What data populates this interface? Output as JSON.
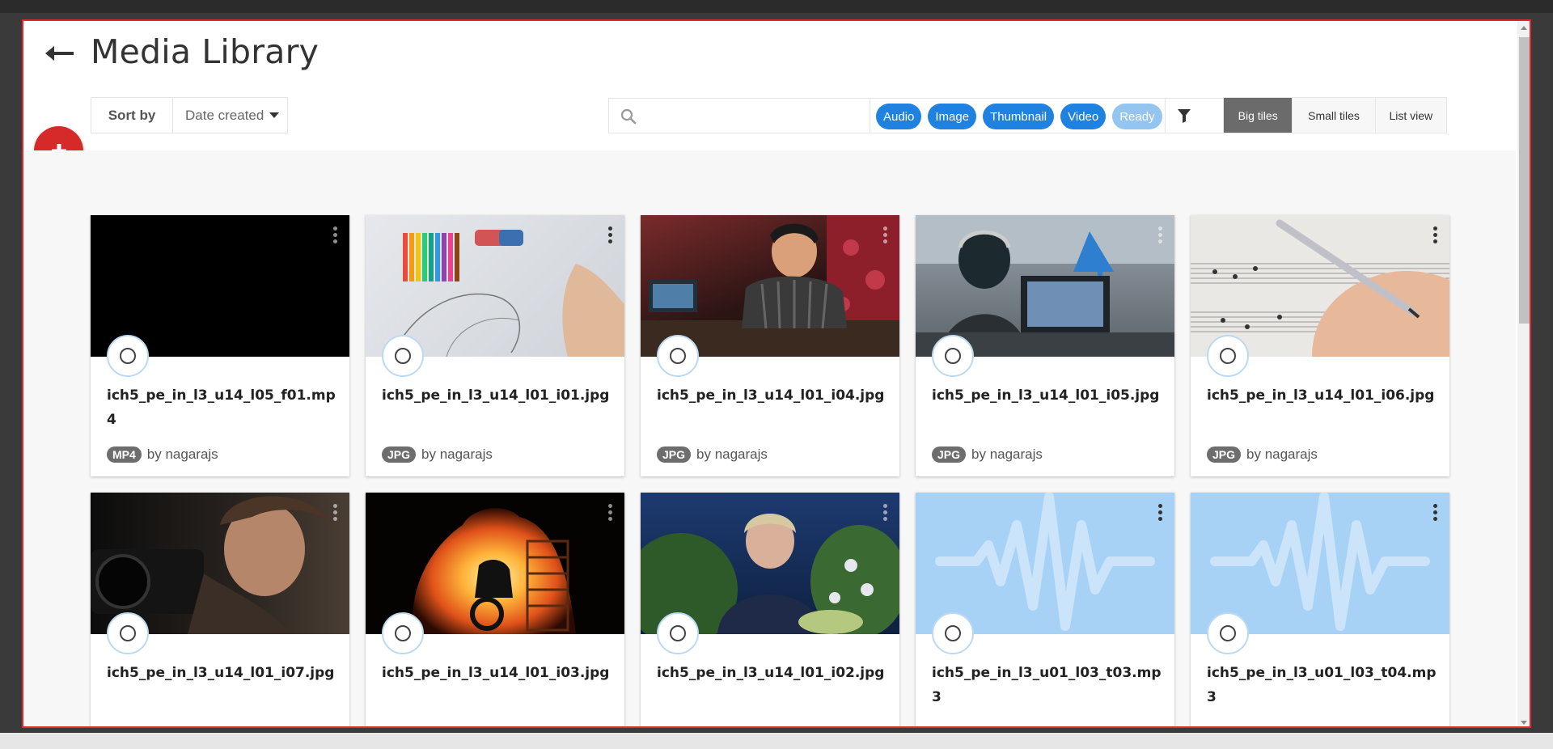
{
  "header": {
    "title": "Media Library",
    "back_icon": "arrow-left-icon"
  },
  "sort": {
    "label": "Sort by",
    "value": "Date created"
  },
  "add_button": {
    "icon": "plus-icon",
    "color": "#d62a2a"
  },
  "search": {
    "placeholder": "",
    "value": "",
    "icon": "search-icon"
  },
  "filter_chips": [
    {
      "label": "Audio",
      "active": true
    },
    {
      "label": "Image",
      "active": true
    },
    {
      "label": "Thumbnail",
      "active": true
    },
    {
      "label": "Video",
      "active": true
    },
    {
      "label": "Ready",
      "active": false
    }
  ],
  "filter_icon": "funnel-icon",
  "view_toggle": [
    {
      "label": "Big tiles",
      "active": true
    },
    {
      "label": "Small tiles",
      "active": false
    },
    {
      "label": "List view",
      "active": false
    }
  ],
  "colors": {
    "accent": "#1f82e0",
    "chip_inactive": "#94c4f0",
    "danger": "#d62a2a",
    "audio_thumb": "#a8d2f5"
  },
  "media": [
    {
      "filename": "ich5_pe_in_l3_u14_l05_f01.mp4",
      "type": "MP4",
      "author": "by nagarajs",
      "thumb": "video-black"
    },
    {
      "filename": "ich5_pe_in_l3_u14_l01_i01.jpg",
      "type": "JPG",
      "author": "by nagarajs",
      "thumb": "pencil-sketch"
    },
    {
      "filename": "ich5_pe_in_l3_u14_l01_i04.jpg",
      "type": "JPG",
      "author": "by nagarajs",
      "thumb": "dj-studio"
    },
    {
      "filename": "ich5_pe_in_l3_u14_l01_i05.jpg",
      "type": "JPG",
      "author": "by nagarajs",
      "thumb": "digital-artist"
    },
    {
      "filename": "ich5_pe_in_l3_u14_l01_i06.jpg",
      "type": "JPG",
      "author": "by nagarajs",
      "thumb": "sheet-music"
    },
    {
      "filename": "ich5_pe_in_l3_u14_l01_i07.jpg",
      "type": "",
      "author": "",
      "thumb": "photographer"
    },
    {
      "filename": "ich5_pe_in_l3_u14_l01_i03.jpg",
      "type": "",
      "author": "",
      "thumb": "fire-stunt"
    },
    {
      "filename": "ich5_pe_in_l3_u14_l01_i02.jpg",
      "type": "",
      "author": "",
      "thumb": "talk-show"
    },
    {
      "filename": "ich5_pe_in_l3_u01_l03_t03.mp3",
      "type": "",
      "author": "",
      "thumb": "audio-wave"
    },
    {
      "filename": "ich5_pe_in_l3_u01_l03_t04.mp3",
      "type": "",
      "author": "",
      "thumb": "audio-wave"
    }
  ]
}
